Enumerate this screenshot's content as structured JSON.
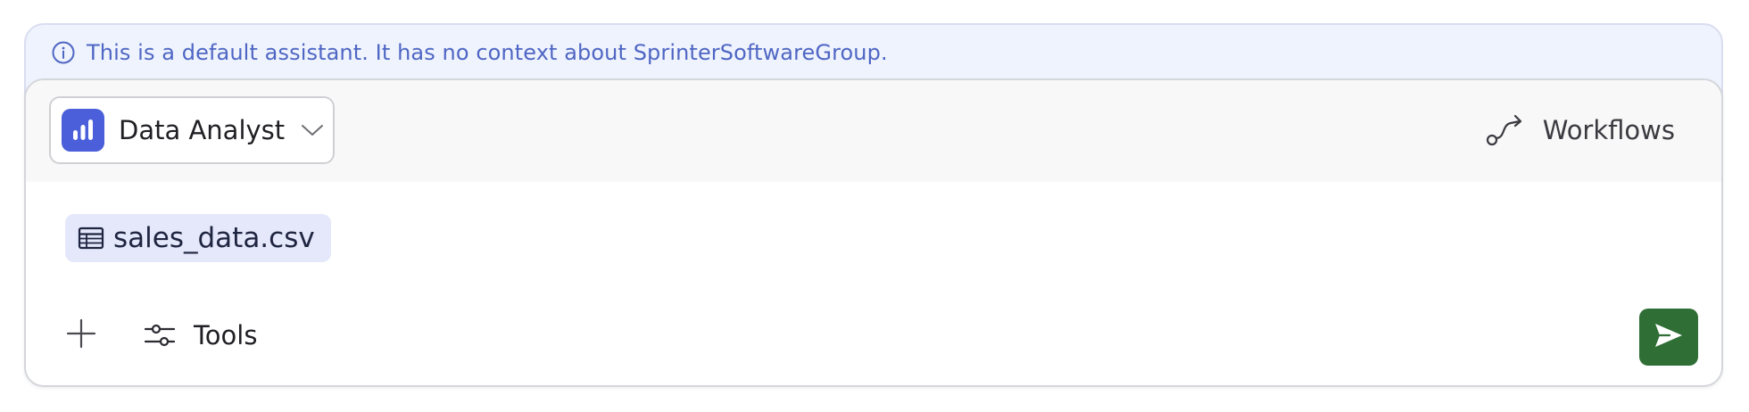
{
  "banner": {
    "icon": "info-icon",
    "text": "This is a default assistant. It has no context about SprinterSoftwareGroup."
  },
  "assistant_selector": {
    "icon": "bar-chart-icon",
    "label": "Data Analyst",
    "chevron": "chevron-down-icon"
  },
  "workflows": {
    "icon": "workflow-route-icon",
    "label": "Workflows"
  },
  "attachment": {
    "icon": "table-icon",
    "label": "sales_data.csv"
  },
  "toolbar": {
    "add_icon": "plus-icon",
    "tools_icon": "sliders-icon",
    "tools_label": "Tools",
    "send_icon": "send-icon"
  },
  "colors": {
    "banner_bg": "#eef3fd",
    "banner_text": "#4f66c4",
    "assistant_icon_bg": "#4a5fd9",
    "chip_bg": "#e4e8fa",
    "send_bg": "#2f6e35"
  }
}
